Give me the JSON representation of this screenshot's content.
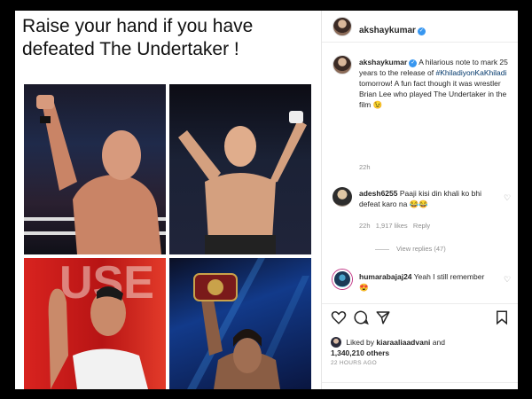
{
  "post": {
    "headline": "Raise your hand if you have defeated The Undertaker !"
  },
  "header": {
    "username": "akshaykumar",
    "verified_mark": "✓",
    "more": "···"
  },
  "caption": {
    "username": "akshaykumar",
    "text": "A hilarious note to mark 25 years to the release of",
    "hashtag": "#KhiladiyonKaKhiladi",
    "text2": "tomorrow! A fun fact though it was wrestler Brian Lee who played The Undertaker in the film 😉",
    "time": "22h"
  },
  "comments": [
    {
      "username": "adesh6255",
      "text": "Paaji kisi din khali ko bhi defeat karo na 😂😂",
      "time": "22h",
      "likes": "1,917 likes",
      "reply": "Reply",
      "view_replies": "View replies (47)"
    },
    {
      "username": "humarabajaj24",
      "text": "Yeah I still remember 😍"
    }
  ],
  "actions": {
    "liked_by_prefix": "Liked by",
    "liked_by_user": "kiaraaliaadvani",
    "liked_by_and": "and",
    "others": "1,340,210 others",
    "timestamp": "22 HOURS AGO"
  },
  "icons": [
    "heart-icon",
    "comment-icon",
    "share-icon",
    "bookmark-icon",
    "more-icon"
  ],
  "colors": {
    "link": "#00376b",
    "verified": "#3897f0",
    "muted": "#8e8e8e"
  }
}
